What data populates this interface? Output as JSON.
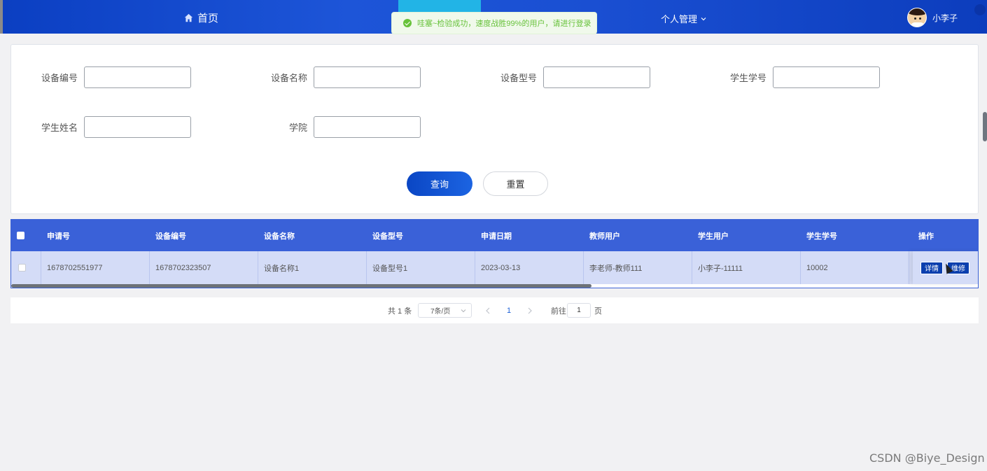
{
  "nav": {
    "home_label": "首页",
    "personal_label": "个人管理",
    "username": "小李子"
  },
  "toast": {
    "message": "哇塞~检验成功，速度战胜99%的用户，请进行登录"
  },
  "search": {
    "fields": [
      {
        "label": "设备编号",
        "value": ""
      },
      {
        "label": "设备名称",
        "value": ""
      },
      {
        "label": "设备型号",
        "value": ""
      },
      {
        "label": "学生学号",
        "value": ""
      },
      {
        "label": "学生姓名",
        "value": ""
      },
      {
        "label": "学院",
        "value": ""
      }
    ],
    "query_label": "查询",
    "reset_label": "重置"
  },
  "table": {
    "headers": [
      "申请号",
      "设备编号",
      "设备名称",
      "设备型号",
      "申请日期",
      "教师用户",
      "学生用户",
      "学生学号",
      "操作"
    ],
    "rows": [
      {
        "cells": [
          "1678702551977",
          "1678702323507",
          "设备名称1",
          "设备型号1",
          "2023-03-13",
          "李老师-教师111",
          "小李子-11111",
          "10002"
        ],
        "actions": [
          "详情",
          "维修"
        ]
      }
    ]
  },
  "pagination": {
    "total_text": "共 1 条",
    "page_size": "7条/页",
    "current_page": "1",
    "goto_prefix": "前往",
    "goto_value": "1",
    "goto_suffix": "页"
  },
  "watermark": "CSDN @Biye_Design",
  "colors": {
    "header_bg": "#1a4fd2",
    "table_header": "#3a61d8",
    "row_bg": "#d4dcf7",
    "primary_button": "#0a46c4",
    "success": "#67c23a"
  }
}
